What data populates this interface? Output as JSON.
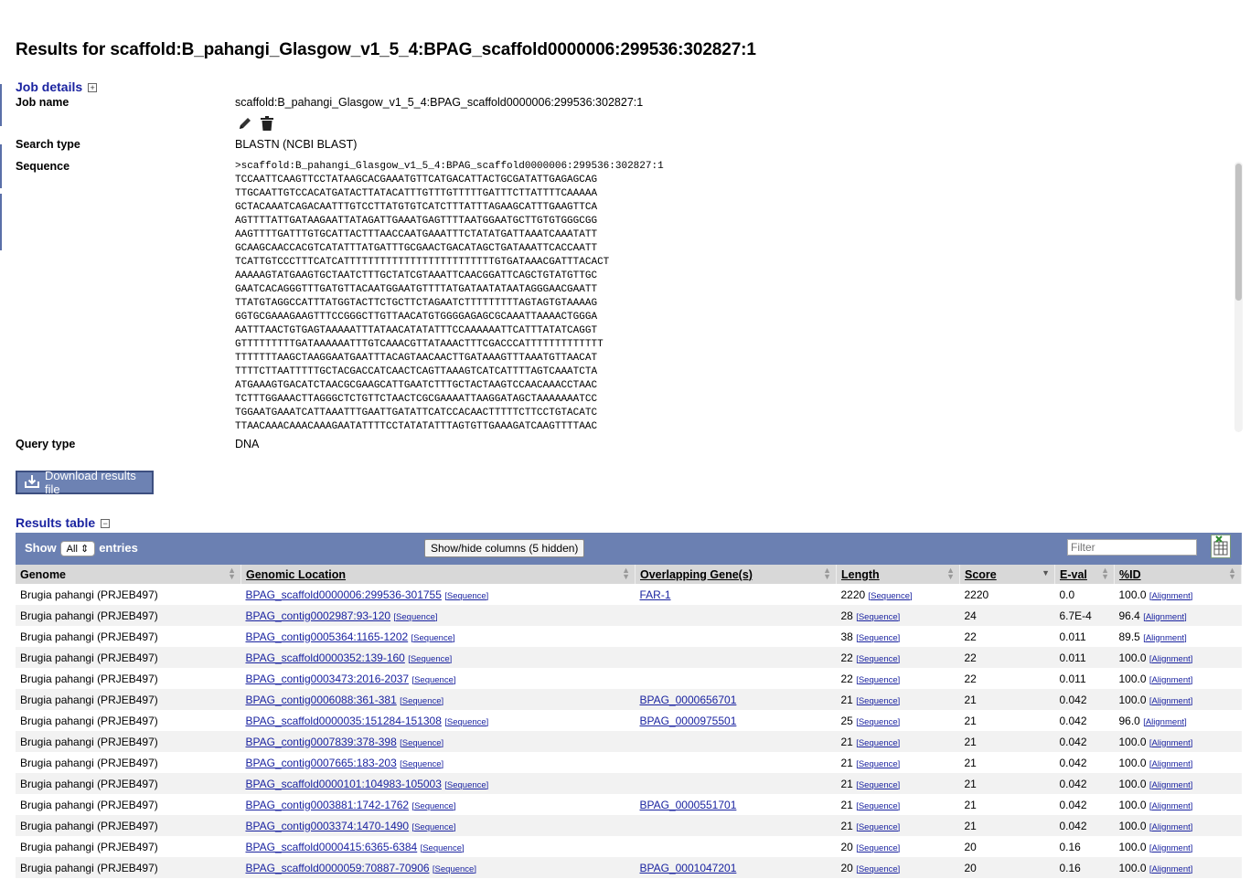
{
  "page_title": "Results for scaffold:B_pahangi_Glasgow_v1_5_4:BPAG_scaffold0000006:299536:302827:1",
  "job_details": {
    "heading": "Job details",
    "toggle": "+",
    "job_name_label": "Job name",
    "job_name_value": "scaffold:B_pahangi_Glasgow_v1_5_4:BPAG_scaffold0000006:299536:302827:1",
    "search_type_label": "Search type",
    "search_type_value": "BLASTN (NCBI BLAST)",
    "sequence_label": "Sequence",
    "sequence_text": ">scaffold:B_pahangi_Glasgow_v1_5_4:BPAG_scaffold0000006:299536:302827:1\nTCCAATTCAAGTTCCTATAAGCACGAAATGTTCATGACATTACTGCGATATTGAGAGCAG\nTTGCAATTGTCCACATGATACTTATACATTTGTTTGTTTTTGATTTCTTATTTTCAAAAA\nGCTACAAATCAGACAATTTGTCCTTATGTGTCATCTTTATTTAGAAGCATTTGAAGTTCA\nAGTTTTATTGATAAGAATTATAGATTGAAATGAGTTTTAATGGAATGCTTGTGTGGGCGG\nAAGTTTTGATTTGTGCATTACTTTAACCAATGAAATTTCTATATGATTAAATCAAATATT\nGCAAGCAACCACGTCATATTTATGATTTGCGAACTGACATAGCTGATAAATTCACCAATT\nTCATTGTCCCTTTCATCATTTTTTTTTTTTTTTTTTTTTTTTTGTGATAAACGATTTACACT\nAAAAAGTATGAAGTGCTAATCTTTGCTATCGTAAATTCAACGGATTCAGCTGTATGTTGC\nGAATCACAGGGTTTGATGTTACAATGGAATGTTTTATGATAATATAATAGGGAACGAATT\nTTATGTAGGCCATTTATGGTACTTCTGCTTCTAGAATCTTTTTTTTTAGTAGTGTAAAAG\nGGTGCGAAAGAAGTTTCCGGGCTTGTTAACATGTGGGGAGAGCGCAAATTAAAACTGGGA\nAATTTAACTGTGAGTAAAAATTTATAACATATATTTCCAAAAAATTCATTTATATCAGGT\nGTTTTTTTTTGATAAAAAATTTGTCAAACGTTATAAACTTTCGACCCATTTTTTTTTTTTT\nTTTTTTTAAGCTAAGGAATGAATTTACAGTAACAACTTGATAAAGTTTAAATGTTAACAT\nTTTTCTTAATTTTTGCTACGACCATCAACTCAGTTAAAGTCATCATTTTAGTCAAATCTA\nATGAAAGTGACATCTAACGCGAAGCATTGAATCTTTGCTACTAAGTCCAACAAACCTAAC\nTCTTTGGAAACTTAGGGCTCTGTTCTAACTCGCGAAAATTAAGGATAGCTAAAAAAATCC\nTGGAATGAAATCATTAAATTTGAATTGATATTCATCCACAACTTTTTCTTCCTGTACATC\nTTAACAAACAAACAAAGAATATTTTCCTATATATTTAGTGTTGAAAGATCAAGTTTTAAC",
    "query_type_label": "Query type",
    "query_type_value": "DNA"
  },
  "download_button": "Download results file",
  "results_table": {
    "heading": "Results table",
    "toggle": "−",
    "show_label": "Show",
    "show_value": "All",
    "entries_label": "entries",
    "columns_button": "Show/hide columns (5 hidden)",
    "filter_placeholder": "Filter",
    "columns": [
      "Genome",
      "Genomic Location",
      "Overlapping Gene(s)",
      "Length",
      "Score",
      "E-val",
      "%ID"
    ],
    "sequence_link": "[Sequence]",
    "alignment_link": "[Alignment]",
    "rows": [
      {
        "genome": "Brugia pahangi (PRJEB497)",
        "location": "BPAG_scaffold0000006:299536-301755",
        "gene": "FAR-1",
        "length": "2220",
        "score": "2220",
        "eval": "0.0",
        "pid": "100.0"
      },
      {
        "genome": "Brugia pahangi (PRJEB497)",
        "location": "BPAG_contig0002987:93-120",
        "gene": "",
        "length": "28",
        "score": "24",
        "eval": "6.7E-4",
        "pid": "96.4"
      },
      {
        "genome": "Brugia pahangi (PRJEB497)",
        "location": "BPAG_contig0005364:1165-1202",
        "gene": "",
        "length": "38",
        "score": "22",
        "eval": "0.011",
        "pid": "89.5"
      },
      {
        "genome": "Brugia pahangi (PRJEB497)",
        "location": "BPAG_scaffold0000352:139-160",
        "gene": "",
        "length": "22",
        "score": "22",
        "eval": "0.011",
        "pid": "100.0"
      },
      {
        "genome": "Brugia pahangi (PRJEB497)",
        "location": "BPAG_contig0003473:2016-2037",
        "gene": "",
        "length": "22",
        "score": "22",
        "eval": "0.011",
        "pid": "100.0"
      },
      {
        "genome": "Brugia pahangi (PRJEB497)",
        "location": "BPAG_contig0006088:361-381",
        "gene": "BPAG_0000656701",
        "length": "21",
        "score": "21",
        "eval": "0.042",
        "pid": "100.0"
      },
      {
        "genome": "Brugia pahangi (PRJEB497)",
        "location": "BPAG_scaffold0000035:151284-151308",
        "gene": "BPAG_0000975501",
        "length": "25",
        "score": "21",
        "eval": "0.042",
        "pid": "96.0"
      },
      {
        "genome": "Brugia pahangi (PRJEB497)",
        "location": "BPAG_contig0007839:378-398",
        "gene": "",
        "length": "21",
        "score": "21",
        "eval": "0.042",
        "pid": "100.0"
      },
      {
        "genome": "Brugia pahangi (PRJEB497)",
        "location": "BPAG_contig0007665:183-203",
        "gene": "",
        "length": "21",
        "score": "21",
        "eval": "0.042",
        "pid": "100.0"
      },
      {
        "genome": "Brugia pahangi (PRJEB497)",
        "location": "BPAG_scaffold0000101:104983-105003",
        "gene": "",
        "length": "21",
        "score": "21",
        "eval": "0.042",
        "pid": "100.0"
      },
      {
        "genome": "Brugia pahangi (PRJEB497)",
        "location": "BPAG_contig0003881:1742-1762",
        "gene": "BPAG_0000551701",
        "length": "21",
        "score": "21",
        "eval": "0.042",
        "pid": "100.0"
      },
      {
        "genome": "Brugia pahangi (PRJEB497)",
        "location": "BPAG_contig0003374:1470-1490",
        "gene": "",
        "length": "21",
        "score": "21",
        "eval": "0.042",
        "pid": "100.0"
      },
      {
        "genome": "Brugia pahangi (PRJEB497)",
        "location": "BPAG_scaffold0000415:6365-6384",
        "gene": "",
        "length": "20",
        "score": "20",
        "eval": "0.16",
        "pid": "100.0"
      },
      {
        "genome": "Brugia pahangi (PRJEB497)",
        "location": "BPAG_scaffold0000059:70887-70906",
        "gene": "BPAG_0001047201",
        "length": "20",
        "score": "20",
        "eval": "0.16",
        "pid": "100.0"
      }
    ]
  },
  "colors": {
    "accent": "#6b80b2",
    "link": "#1a23a0",
    "header_bg": "#d8d8d8",
    "stripe": "#f2f2f2"
  }
}
